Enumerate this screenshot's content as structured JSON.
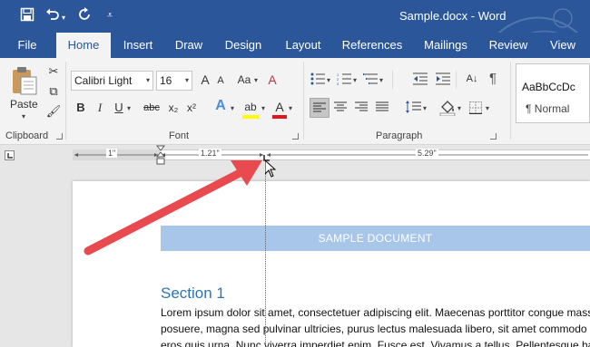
{
  "titlebar": {
    "document_title": "Sample.docx - Word",
    "save_icon": "save-icon",
    "undo_icon": "undo-icon",
    "redo_icon": "redo-icon",
    "customize_icon": "customize-qat-icon"
  },
  "tabs": [
    {
      "label": "File"
    },
    {
      "label": "Home"
    },
    {
      "label": "Insert"
    },
    {
      "label": "Draw"
    },
    {
      "label": "Design"
    },
    {
      "label": "Layout"
    },
    {
      "label": "References"
    },
    {
      "label": "Mailings"
    },
    {
      "label": "Review"
    },
    {
      "label": "View"
    }
  ],
  "active_tab": "Home",
  "ribbon": {
    "clipboard": {
      "paste_label": "Paste",
      "group_label": "Clipboard"
    },
    "font": {
      "font_name": "Calibri Light",
      "font_size": "16",
      "group_label": "Font",
      "bold": "B",
      "italic": "I",
      "underline": "U",
      "strike": "abc",
      "subscript": "x₂",
      "superscript": "x²",
      "grow": "A",
      "shrink": "A",
      "case": "Aa",
      "clear": "A",
      "effects": "A",
      "highlight": "ab",
      "color": "A"
    },
    "paragraph": {
      "group_label": "Paragraph",
      "pilcrow": "¶"
    },
    "styles": {
      "preview_text": "AaBbCcDc",
      "style_name": "¶ Normal"
    }
  },
  "ruler": {
    "left_indent_measure": "1\"",
    "tab_measure": "1.21\"",
    "right_measure": "5.29\""
  },
  "document": {
    "banner_text": "SAMPLE DOCUMENT",
    "section_title": "Section 1",
    "body_lines": [
      "Lorem ipsum dolor sit amet, consectetuer adipiscing elit. Maecenas porttitor congue massa. Fusce",
      "posuere, magna sed pulvinar ultricies, purus lectus malesuada libero, sit amet commodo magna",
      "eros quis urna. Nunc viverra imperdiet enim. Fusce est. Vivamus a tellus. Pellentesque habitant"
    ]
  },
  "colors": {
    "word_blue": "#2b579a",
    "banner_blue": "#a8c6e9",
    "heading_blue": "#2e74b5",
    "annotation_arrow": "#e84a4f"
  }
}
